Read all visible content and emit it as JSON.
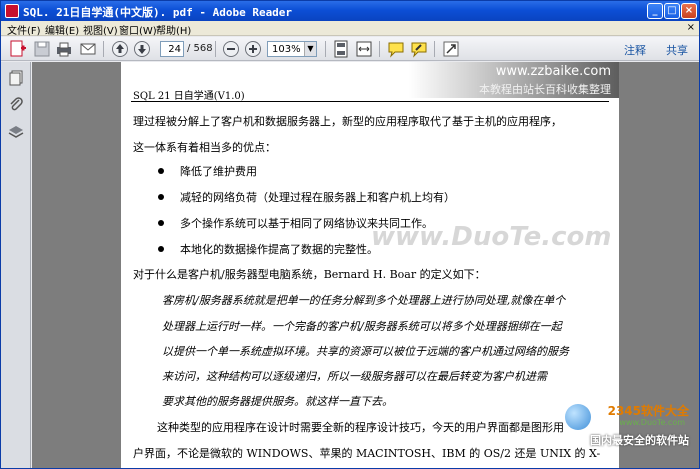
{
  "window": {
    "title": "SQL. 21日自学通(中文版). pdf - Adobe Reader"
  },
  "menu": {
    "items": [
      "文件(F)",
      "编辑(E)",
      "视图(V)",
      "窗口(W)",
      "帮助(H)"
    ],
    "close": "×"
  },
  "toolbar": {
    "current_page": "24",
    "total_pages": "/ 568",
    "zoom": "103%",
    "comment_label": "注释",
    "share_label": "共享"
  },
  "document": {
    "banner_url": "www.zzbaike.com",
    "banner_sub": "本教程由站长百科收集整理",
    "running_head": "SQL 21 日自学通(V1.0)",
    "lines": [
      "理过程被分解上了客户机和数据服务器上，新型的应用程序取代了基于主机的应用程序，",
      "这一体系有着相当多的优点："
    ],
    "bullets": [
      "降低了维护费用",
      "减轻的网络负荷（处理过程在服务器上和客户机上均有）",
      "多个操作系统可以基于相同了网络协议来共同工作。",
      "本地化的数据操作提高了数据的完整性。"
    ],
    "intro": "对于什么是客户机/服务器型电脑系统，Bernard H. Boar 的定义如下：",
    "quote_lines": [
      "客房机/服务器系统就是把单一的任务分解到多个处理器上进行协同处理,就像在单个",
      "处理器上运行时一样。一个完备的客户机/服务器系统可以将多个处理器捆绑在一起",
      "以提供一个单一系统虚拟环境。共享的资源可以被位于远端的客户机通过网络的服务",
      "来访问，这种结构可以逐级递归，所以一级服务器可以在最后转变为客户机进需",
      "要求其他的服务器提供服务。就这样一直下去。"
    ],
    "tail_lines": [
      "这种类型的应用程序在设计时需要全新的程序设计技巧，今天的用户界面都是图形用",
      "户界面，不论是微软的 WINDOWS、苹果的 MACINTOSH、IBM 的 OS/2 还是 UNIX 的 X-"
    ]
  },
  "overlays": {
    "watermark": "www.DuoTe.com",
    "corner_brand": "2345软件大全",
    "corner_url": "www.DuoTe.com",
    "corner_sub": "国内最安全的软件站"
  }
}
